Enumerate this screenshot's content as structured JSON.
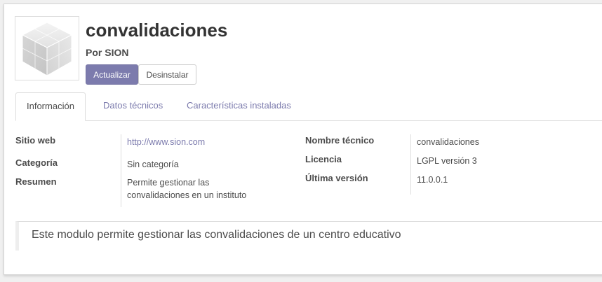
{
  "module": {
    "title": "convalidaciones",
    "author": "Por SION",
    "icon": "cube-icon"
  },
  "buttons": {
    "update": "Actualizar",
    "uninstall": "Desinstalar"
  },
  "tabs": [
    {
      "label": "Información",
      "active": true
    },
    {
      "label": "Datos técnicos",
      "active": false
    },
    {
      "label": "Características instaladas",
      "active": false
    }
  ],
  "fields_left": {
    "website_label": "Sitio web",
    "website_value": "http://www.sion.com",
    "category_label": "Categoría",
    "category_value": "Sin categoría",
    "summary_label": "Resumen",
    "summary_line1": "Permite gestionar las",
    "summary_line2": "convalidaciones en un instituto"
  },
  "fields_right": {
    "technical_name_label": "Nombre técnico",
    "technical_name_value": "convalidaciones",
    "license_label": "Licencia",
    "license_value": "LGPL versión 3",
    "latest_version_label": "Última versión",
    "latest_version_value": "11.0.0.1"
  },
  "description": "Este modulo permite gestionar las convalidaciones de un centro educativo",
  "colors": {
    "accent": "#7c7bad",
    "text": "#4c4c4c"
  }
}
